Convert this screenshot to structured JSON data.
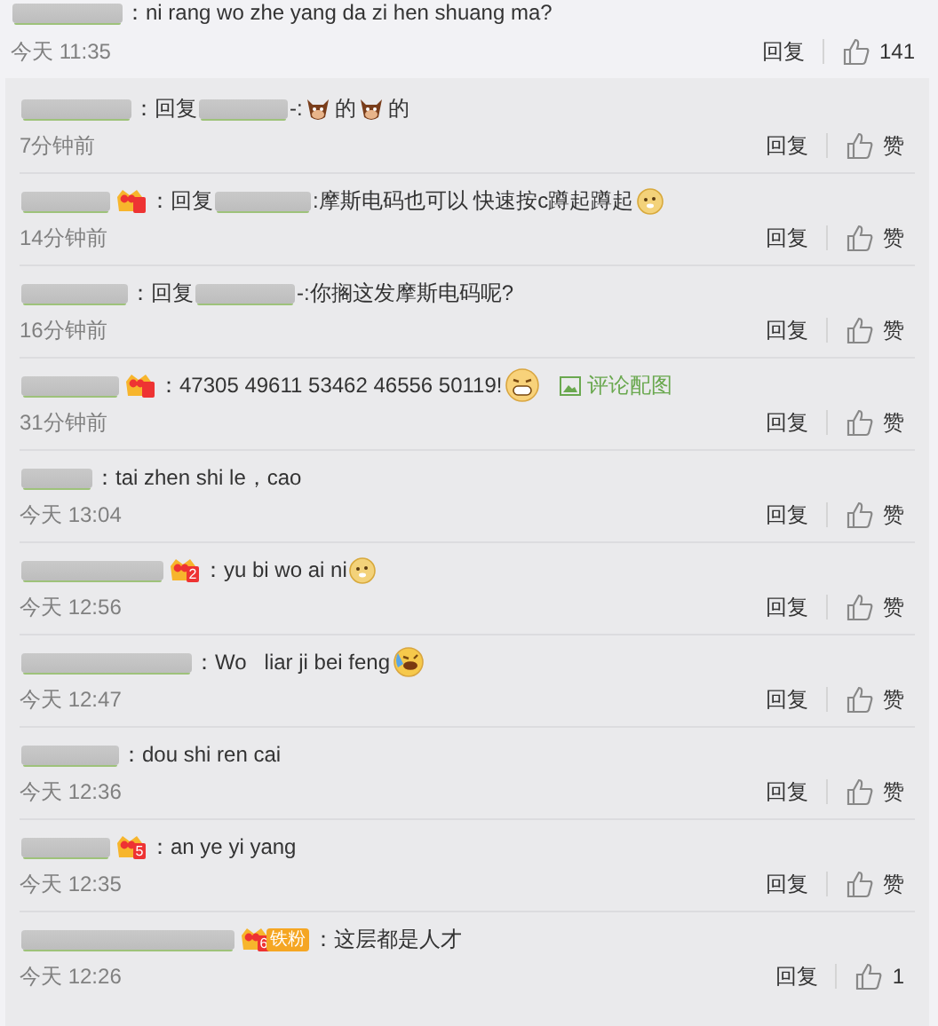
{
  "main_comment": {
    "parts": [
      {
        "kind": "name"
      },
      {
        "kind": "text",
        "text": "：ni rang wo zhe yang da zi hen shuang ma?"
      }
    ],
    "time": "今天 11:35",
    "reply": "回复",
    "like": "141"
  },
  "replies": [
    {
      "parts": [
        {
          "kind": "name"
        },
        {
          "kind": "text",
          "text": "：回复"
        },
        {
          "kind": "name"
        },
        {
          "kind": "text",
          "text": "-:"
        },
        {
          "kind": "cow_emoji"
        },
        {
          "kind": "text",
          "text": "的"
        },
        {
          "kind": "cow_emoji"
        },
        {
          "kind": "text",
          "text": "的"
        }
      ],
      "time": "7分钟前",
      "reply": "回复",
      "like": "赞"
    },
    {
      "parts": [
        {
          "kind": "name"
        },
        {
          "kind": "badge"
        },
        {
          "kind": "text",
          "text": "：回复"
        },
        {
          "kind": "name"
        },
        {
          "kind": "text",
          "text": ":摩斯电码也可以 快速按c蹲起蹲起"
        },
        {
          "kind": "doge_emoji"
        }
      ],
      "time": "14分钟前",
      "reply": "回复",
      "like": "赞"
    },
    {
      "parts": [
        {
          "kind": "name"
        },
        {
          "kind": "text",
          "text": "：回复"
        },
        {
          "kind": "name"
        },
        {
          "kind": "text",
          "text": "-:你搁这发摩斯电码呢?"
        }
      ],
      "time": "16分钟前",
      "reply": "回复",
      "like": "赞"
    },
    {
      "parts": [
        {
          "kind": "name"
        },
        {
          "kind": "badge"
        },
        {
          "kind": "text",
          "text": "：47305 49611 53462 46556 50119!"
        },
        {
          "kind": "grin_emoji"
        },
        {
          "kind": "image_link",
          "text": "评论配图"
        }
      ],
      "time": "31分钟前",
      "reply": "回复",
      "like": "赞"
    },
    {
      "parts": [
        {
          "kind": "name"
        },
        {
          "kind": "text",
          "text": "：tai zhen shi le，cao"
        }
      ],
      "time": "今天 13:04",
      "reply": "回复",
      "like": "赞"
    },
    {
      "parts": [
        {
          "kind": "name"
        },
        {
          "kind": "badge",
          "level": "2"
        },
        {
          "kind": "text",
          "text": "：yu bi wo ai ni"
        },
        {
          "kind": "doge_emoji"
        }
      ],
      "time": "今天 12:56",
      "reply": "回复",
      "like": "赞"
    },
    {
      "parts": [
        {
          "kind": "name"
        },
        {
          "kind": "text",
          "text": "：Wo   liar ji bei feng"
        },
        {
          "kind": "laugh_emoji"
        }
      ],
      "time": "今天 12:47",
      "reply": "回复",
      "like": "赞"
    },
    {
      "parts": [
        {
          "kind": "name"
        },
        {
          "kind": "text",
          "text": "：dou shi ren cai"
        }
      ],
      "time": "今天 12:36",
      "reply": "回复",
      "like": "赞"
    },
    {
      "parts": [
        {
          "kind": "name"
        },
        {
          "kind": "badge",
          "level": "5"
        },
        {
          "kind": "text",
          "text": "：an ye yi yang"
        }
      ],
      "time": "今天 12:35",
      "reply": "回复",
      "like": "赞"
    },
    {
      "parts": [
        {
          "kind": "name"
        },
        {
          "kind": "badge",
          "level": "6",
          "tag": "铁粉"
        },
        {
          "kind": "text",
          "text": "：这层都是人才"
        }
      ],
      "time": "今天 12:26",
      "reply": "回复",
      "like": "1"
    }
  ]
}
